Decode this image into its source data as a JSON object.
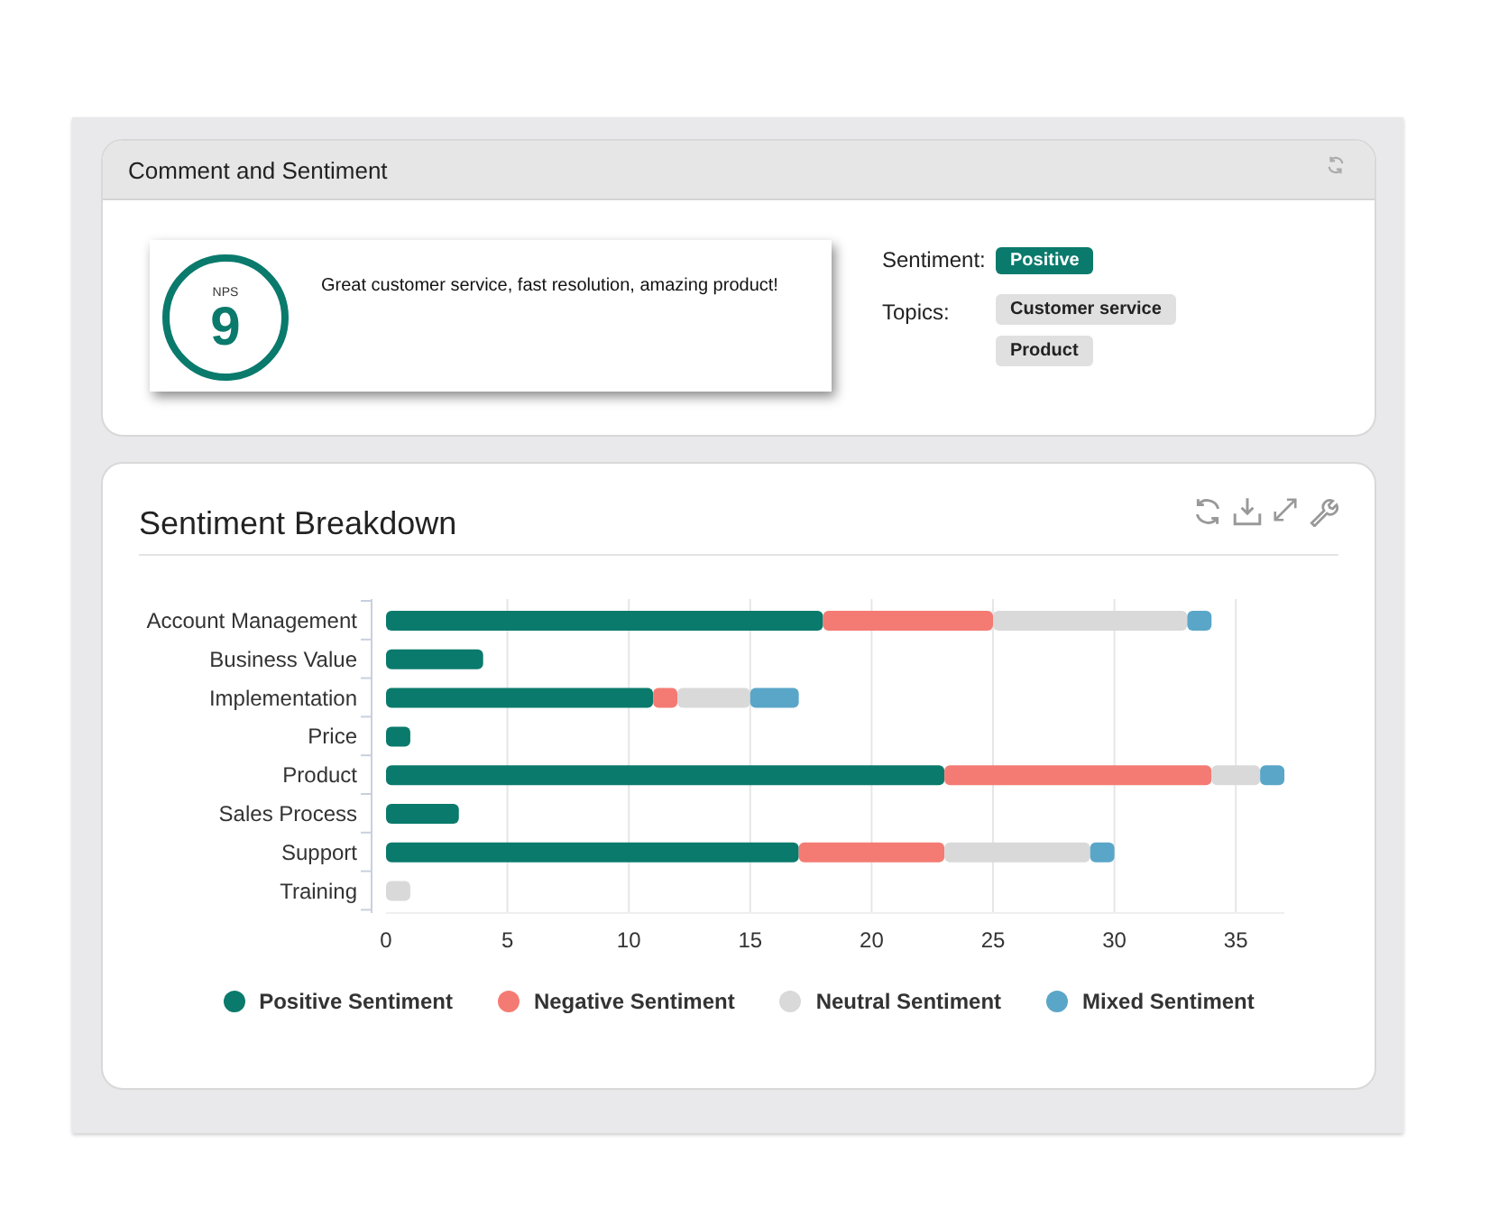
{
  "comment_panel": {
    "title": "Comment and Sentiment",
    "nps_label": "NPS",
    "nps_score": "9",
    "comment": "Great customer service, fast resolution, amazing product!",
    "sentiment_label": "Sentiment:",
    "sentiment": "Positive",
    "topics_label": "Topics:",
    "topics": [
      "Customer service",
      "Product"
    ]
  },
  "breakdown_panel": {
    "title": "Sentiment Breakdown",
    "chart_data": {
      "type": "bar",
      "orientation": "horizontal",
      "stacked": true,
      "categories": [
        "Account Management",
        "Business Value",
        "Implementation",
        "Price",
        "Product",
        "Sales Process",
        "Support",
        "Training"
      ],
      "series": [
        {
          "name": "Positive Sentiment",
          "color": "#0a7a6c",
          "values": [
            18,
            4,
            11,
            1,
            23,
            3,
            17,
            0
          ]
        },
        {
          "name": "Negative Sentiment",
          "color": "#f47b73",
          "values": [
            7,
            0,
            1,
            0,
            11,
            0,
            6,
            0
          ]
        },
        {
          "name": "Neutral Sentiment",
          "color": "#d9d9d9",
          "values": [
            8,
            0,
            3,
            0,
            2,
            0,
            6,
            1
          ]
        },
        {
          "name": "Mixed Sentiment",
          "color": "#5aa6c8",
          "values": [
            1,
            0,
            2,
            0,
            1,
            0,
            1,
            0
          ]
        }
      ],
      "grid": true,
      "xlim": [
        0,
        37
      ],
      "xticks": [
        0,
        5,
        10,
        15,
        20,
        25,
        30,
        35
      ]
    }
  }
}
